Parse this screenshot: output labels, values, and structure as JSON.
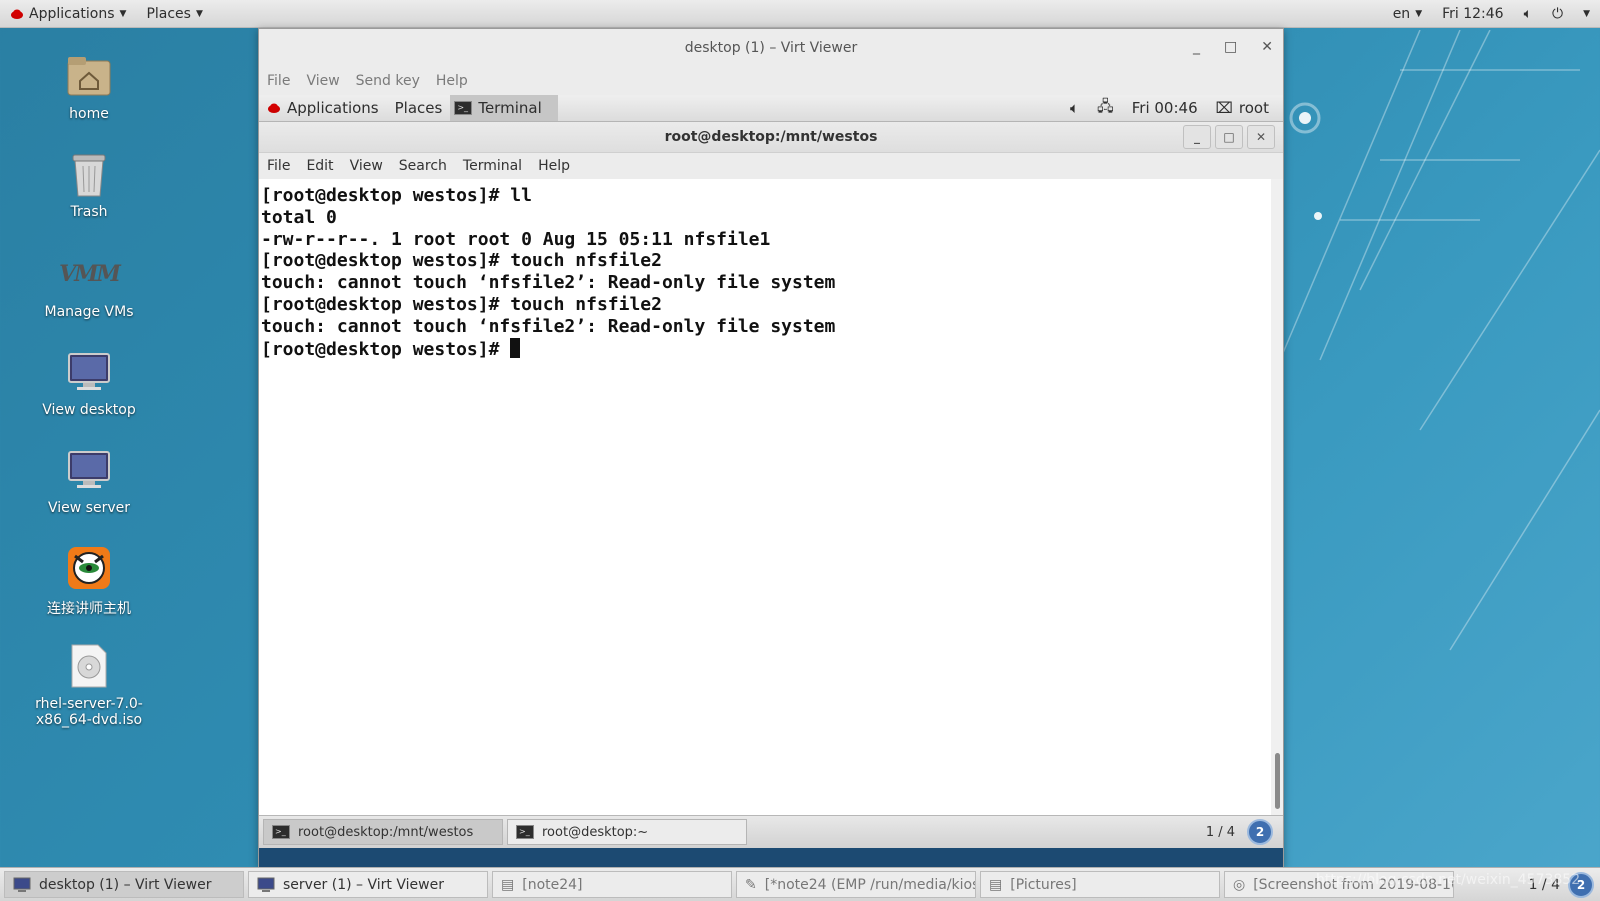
{
  "host_topbar": {
    "applications": "Applications",
    "places": "Places",
    "lang": "en",
    "clock": "Fri 12:46"
  },
  "desktop_icons": [
    {
      "label": "home",
      "icon": "home-folder-icon"
    },
    {
      "label": "Trash",
      "icon": "trash-icon"
    },
    {
      "label": "Manage VMs",
      "icon": "vmm-icon"
    },
    {
      "label": "View desktop",
      "icon": "monitor-icon"
    },
    {
      "label": "View server",
      "icon": "monitor-icon"
    },
    {
      "label": "连接讲师主机",
      "icon": "tiger-icon"
    },
    {
      "label": "rhel-server-7.0-x86_64-dvd.iso",
      "icon": "disc-icon"
    }
  ],
  "virt_viewer": {
    "title": "desktop (1) – Virt Viewer",
    "menu": [
      "File",
      "View",
      "Send key",
      "Help"
    ]
  },
  "guest_topbar": {
    "applications": "Applications",
    "places": "Places",
    "terminal": "Terminal",
    "clock": "Fri 00:46",
    "user": "root"
  },
  "terminal": {
    "title": "root@desktop:/mnt/westos",
    "menu": [
      "File",
      "Edit",
      "View",
      "Search",
      "Terminal",
      "Help"
    ],
    "lines": [
      "[root@desktop westos]# ll",
      "total 0",
      "-rw-r--r--. 1 root root 0 Aug 15 05:11 nfsfile1",
      "[root@desktop westos]# touch nfsfile2",
      "touch: cannot touch ‘nfsfile2’: Read-only file system",
      "[root@desktop westos]# touch nfsfile2",
      "touch: cannot touch ‘nfsfile2’: Read-only file system",
      "[root@desktop westos]# "
    ]
  },
  "guest_taskbar": {
    "items": [
      "root@desktop:/mnt/westos",
      "root@desktop:~"
    ],
    "workspace": "1 / 4",
    "workspace_badge": "2"
  },
  "host_taskbar": {
    "items": [
      "desktop (1) – Virt Viewer",
      "server (1) – Virt Viewer",
      "[note24]",
      "[*note24 (EMP /run/media/kiosk...",
      "[Pictures]",
      "[Screenshot from 2019-08-16..."
    ],
    "workspace": "1 / 4",
    "workspace_badge": "2"
  },
  "watermark": "https://blog.csdn.net/weixin_4573852"
}
